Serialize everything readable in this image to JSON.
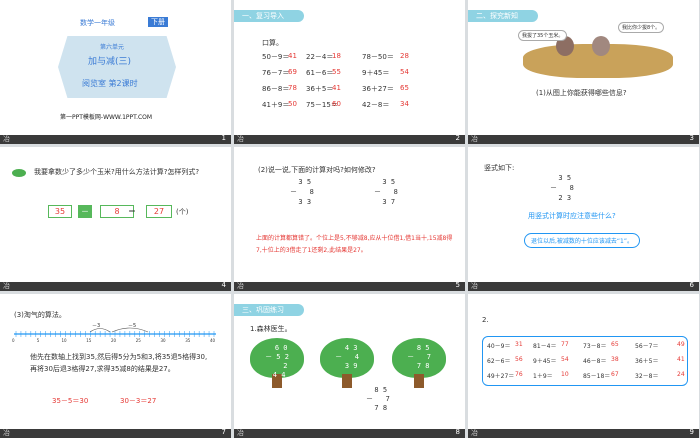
{
  "slides": [
    {
      "num": "1",
      "grade": "数学一年级",
      "volume": "下册",
      "unit": "第六单元",
      "title": "加与减(三)",
      "subtitle": "阅览室  第2课时",
      "brand": "第一PPT模板网-WWW.1PPT.COM",
      "footer": "冶"
    },
    {
      "num": "2",
      "tag": "一、复习导入",
      "heading": "口算。",
      "rows": [
        {
          "q1": "50－9＝",
          "a1": "41",
          "q2": "22－4＝",
          "a2": "18",
          "q3": "78－50＝",
          "a3": "28"
        },
        {
          "q1": "76－7＝",
          "a1": "69",
          "q2": "61－6＝",
          "a2": "55",
          "q3": "9＋45＝",
          "a3": "54"
        },
        {
          "q1": "86－8＝",
          "a1": "78",
          "q2": "36＋5＝",
          "a2": "41",
          "q3": "36＋27＝",
          "a3": "65"
        },
        {
          "q1": "41＋9＝",
          "a1": "50",
          "q2": "75－15＝",
          "a2": "60",
          "q3": "42－8＝",
          "a3": "34"
        }
      ],
      "footer": "冶"
    },
    {
      "num": "3",
      "tag": "二、探究新知",
      "bubble1": "我拔了35个玉米。",
      "bubble2": "我比你少拔8个。",
      "question": "(1)从图上你能获得哪些信息?",
      "footer": "冶"
    },
    {
      "num": "4",
      "question": "我要拿数少了多少个玉米?用什么方法计算?怎样列式?",
      "n1": "35",
      "op": "－",
      "n2": "8",
      "eq": "＝",
      "res": "27",
      "unit": "(个)",
      "footer": "冶"
    },
    {
      "num": "5",
      "question": "(2)说一说,下面的计算对吗?如何修改?",
      "calc1": "  3 5\n－   8\n  3 3",
      "calc2": "  3 5\n－   8\n  3 7",
      "explain": "上面的计算都算错了。个位上是5,不够减8,应从十位借1,借1当十,15减8得7,十位上的3借走了1还剩2,此结果是27。",
      "footer": "冶"
    },
    {
      "num": "6",
      "heading": "竖式如下:",
      "calc": "  3 5\n－   8\n  2 3",
      "ask": "用竖式计算时应注意些什么?",
      "note": "退位以后,被减数的十位应该减去“1”。",
      "footer": "冶"
    },
    {
      "num": "7",
      "heading": "(3)淘气的算法。",
      "jumps": [
        "－3",
        "－5"
      ],
      "ticks": [
        "0",
        "1",
        "2",
        "3",
        "4",
        "5",
        "6",
        "7",
        "8",
        "9",
        "10",
        "11",
        "12",
        "13",
        "14",
        "15",
        "16",
        "17",
        "18",
        "19",
        "20",
        "21",
        "22",
        "23",
        "24",
        "25",
        "26",
        "27",
        "28",
        "29",
        "30",
        "31",
        "32",
        "33",
        "34",
        "35",
        "36",
        "37",
        "38",
        "39",
        "40"
      ],
      "line1": "他先在数轴上找到35,然后得5分为5和3,将35退5格得30,",
      "line2": "再将30后退3格得27,求得35减8的结果是27。",
      "eq1": "35－5＝30",
      "eq2": "30－3＝27",
      "footer": "冶"
    },
    {
      "num": "8",
      "tag": "三、巩固练习",
      "heading": "1.森林医生。",
      "tree1": "  6 0\n－ 5 2\n    2\n 4 4",
      "tree2": "  4 3\n－   4\n  3 9",
      "tree3": "  8 5\n－   7\n  7 8",
      "calc": "  8 5\n－   7\n  7 8",
      "ans1": "4 4",
      "ans2": "3 9",
      "ans3": "7 8",
      "footer": "冶"
    },
    {
      "num": "9",
      "heading": "2.",
      "rows": [
        {
          "q1": "40－9＝",
          "a1": "31",
          "q2": "81－4＝",
          "a2": "77",
          "q3": "73－8＝",
          "a3": "65",
          "q4": "56－7＝",
          "a4": "49"
        },
        {
          "q1": "62－6＝",
          "a1": "56",
          "q2": "9＋45＝",
          "a2": "54",
          "q3": "46－8＝",
          "a3": "38",
          "q4": "36＋5＝",
          "a4": "41"
        },
        {
          "q1": "49＋27＝",
          "a1": "76",
          "q2": "1＋9＝",
          "a2": "10",
          "q3": "85－18＝",
          "a3": "67",
          "q4": "32－8＝",
          "a4": "24"
        }
      ],
      "footer": "冶"
    }
  ]
}
